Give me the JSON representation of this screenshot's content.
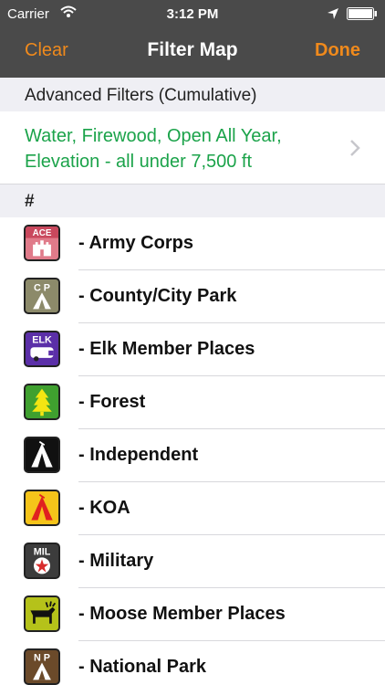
{
  "status_bar": {
    "carrier": "Carrier",
    "time": "3:12 PM"
  },
  "nav": {
    "clear_label": "Clear",
    "title": "Filter Map",
    "done_label": "Done"
  },
  "advanced": {
    "header": "Advanced Filters (Cumulative)",
    "summary_line1": "Water, Firewood, Open All Year,",
    "summary_line2": "Elevation - all under 7,500 ft"
  },
  "section": {
    "header": "#"
  },
  "items": [
    {
      "label": "- Army Corps",
      "icon": "ace-army-corps-icon",
      "badge": "ACE",
      "color": "#e07b8a"
    },
    {
      "label": "- County/City Park",
      "icon": "county-city-park-icon",
      "badge": "C P",
      "color": "#8c8a6a"
    },
    {
      "label": "- Elk Member Places",
      "icon": "elk-icon",
      "badge": "ELK",
      "color": "#5b2fa8"
    },
    {
      "label": "- Forest",
      "icon": "forest-tree-icon",
      "badge": "",
      "color": "#3fa02f"
    },
    {
      "label": "- Independent",
      "icon": "independent-tent-icon",
      "badge": "",
      "color": "#111111"
    },
    {
      "label": "- KOA",
      "icon": "koa-tent-icon",
      "badge": "",
      "color": "#f5c41a"
    },
    {
      "label": "- Military",
      "icon": "military-icon",
      "badge": "MIL",
      "color": "#3c3c3c"
    },
    {
      "label": "- Moose Member Places",
      "icon": "moose-icon",
      "badge": "",
      "color": "#b5c21a"
    },
    {
      "label": "- National Park",
      "icon": "national-park-icon",
      "badge": "N P",
      "color": "#6b4a2a"
    }
  ]
}
